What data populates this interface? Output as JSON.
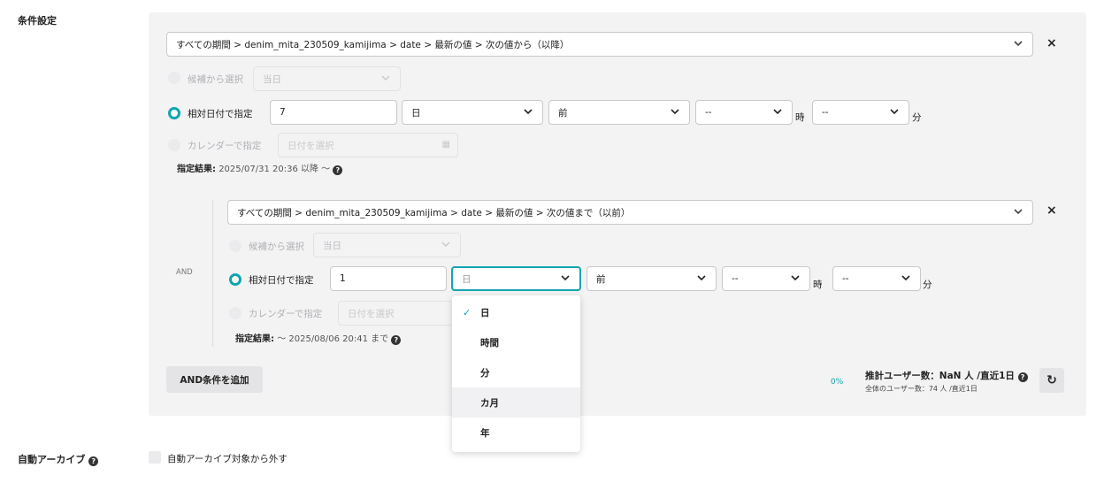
{
  "labels": {
    "conditions": "条件設定",
    "auto_archive": "自動アーカイブ"
  },
  "condition1": {
    "path": "すべての期間 > denim_mita_230509_kamijima > date > 最新の値 > 次の値から（以降）",
    "option_candidate": "候補から選択",
    "candidate_value": "当日",
    "option_relative": "相対日付で指定",
    "relative_value": "7",
    "unit_value": "日",
    "direction_value": "前",
    "hour_value": "--",
    "hour_unit": "時",
    "minute_value": "--",
    "minute_unit": "分",
    "option_calendar": "カレンダーで指定",
    "calendar_placeholder": "日付を選択",
    "result_label": "指定結果:",
    "result_value": "2025/07/31 20:36 以降 ～"
  },
  "and_label": "AND",
  "condition2": {
    "path": "すべての期間 > denim_mita_230509_kamijima > date > 最新の値 > 次の値まで（以前）",
    "option_candidate": "候補から選択",
    "candidate_value": "当日",
    "option_relative": "相対日付で指定",
    "relative_value": "1",
    "unit_value": "日",
    "direction_value": "前",
    "hour_value": "--",
    "hour_unit": "時",
    "minute_value": "--",
    "minute_unit": "分",
    "option_calendar": "カレンダーで指定",
    "calendar_placeholder": "日付を選択",
    "result_label": "指定結果:",
    "result_value": "～ 2025/08/06 20:41 まで"
  },
  "unit_dropdown": {
    "options": [
      "日",
      "時間",
      "分",
      "カ月",
      "年"
    ],
    "selected": "日",
    "hovered": "カ月"
  },
  "footer": {
    "add_button": "AND条件を追加",
    "percent": "0%",
    "estimate": "推計ユーザー数：NaN 人 /直近1日",
    "total": "全体のユーザー数：74 人 /直近1日"
  },
  "archive": {
    "checkbox_label": "自動アーカイブ対象から外す",
    "checked": false
  },
  "colors": {
    "accent": "#12a4b0",
    "panel_bg": "#f3f3f4"
  }
}
